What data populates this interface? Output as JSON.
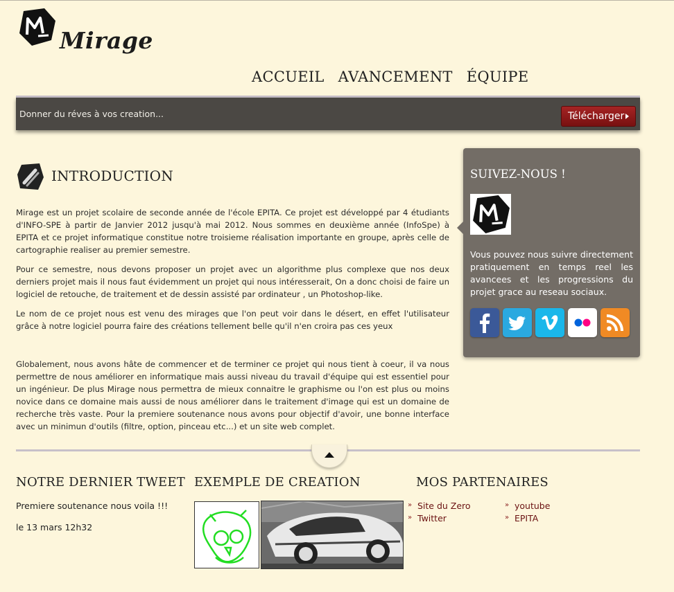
{
  "header": {
    "logo_text": "Mirage",
    "nav": [
      "ACCUEIL",
      "AVANCEMENT",
      "ÉQUIPE"
    ]
  },
  "banner": {
    "tagline": "Donner du réves à vos creation...",
    "download_label": "Télécharger"
  },
  "intro": {
    "title": "INTRODUCTION",
    "paragraphs": [
      "Mirage est un projet scolaire de seconde année de l'école EPITA. Ce projet est développé par 4 étudiants d'INFO-SPE à partir de Janvier 2012 jusqu'à mai 2012. Nous sommes en deuxième année (InfoSpe) à EPITA et ce projet informatique constitue notre troisieme réalisation importante en groupe, après celle de cartographie realiser au premier semestre.",
      "Pour ce semestre, nous devons proposer un projet avec un algorithme plus complexe que nos deux derniers projet mais il nous faut évidemment un projet qui nous intéresserait, On a donc choisi de faire un logiciel de retouche, de traitement et de dessin assisté par ordinateur , un Photoshop-like.",
      "Le nom de ce projet nous est venu des mirages que l'on peut voir dans le désert, en effet l'utilisateur grâce à notre logiciel pourra faire des créations tellement belle qu'il n'en croira pas ces yeux",
      "Globalement, nous avons hâte de commencer et de terminer ce projet qui nous tient à coeur, il va nous permettre de nous améliorer en informatique mais aussi niveau du travail d'équipe qui est essentiel pour un ingénieur. De plus Mirage nous permettra de mieux connaitre le graphisme ou l'on est plus ou moins novice dans ce domaine mais aussi de nous améliorer dans le traitement d'image qui est un domaine de recherche très vaste. Pour la premiere soutenance nous avons pour objectif d'avoir, une bonne interface avec un minimun d'outils (filtre, option, pinceau etc...) et un site web complet."
    ]
  },
  "sidebar": {
    "title": "SUIVEZ-NOUS !",
    "text": "Vous pouvez nous suivre directement pratiquement en temps reel les avancees et les progressions du projet grace au reseau sociaux.",
    "social": [
      {
        "name": "facebook",
        "color": "#3b5998"
      },
      {
        "name": "twitter",
        "color": "#2aa9e0"
      },
      {
        "name": "vimeo",
        "color": "#1ab7ea"
      },
      {
        "name": "flickr",
        "color": "#ffffff"
      },
      {
        "name": "rss",
        "color": "#f08a24"
      }
    ]
  },
  "footer": {
    "tweet_title": "NOTRE DERNIER TWEET",
    "tweet_text": "Premiere soutenance nous voila !!!",
    "tweet_date": "le 13 mars 12h32",
    "creation_title": "EXEMPLE DE CREATION",
    "partners_title": "MOS PARTENAIRES",
    "partners": [
      "Site du Zero",
      "youtube",
      "Twitter",
      "EPITA"
    ]
  },
  "colors": {
    "background": "#fdf6dc",
    "banner": "#4b4844",
    "sidebar": "#736d66",
    "button": "#8e1a1a",
    "link": "#6a1111"
  }
}
